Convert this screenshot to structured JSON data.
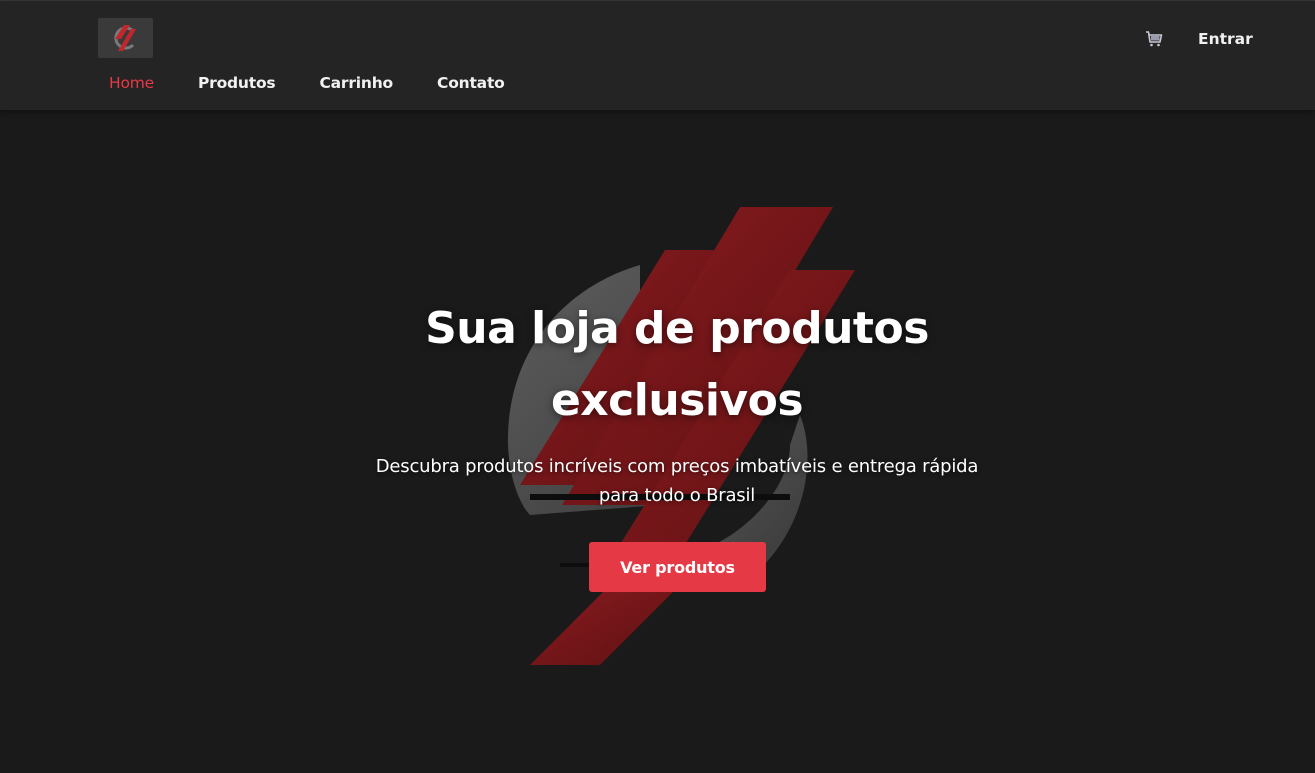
{
  "header": {
    "logo_icon": "brand-logo-icon",
    "nav": [
      {
        "label": "Home",
        "active": true
      },
      {
        "label": "Produtos",
        "active": false
      },
      {
        "label": "Carrinho",
        "active": false
      },
      {
        "label": "Contato",
        "active": false
      }
    ],
    "cart_icon": "shopping-cart-icon",
    "login_label": "Entrar"
  },
  "hero": {
    "background_icon": "brand-logo-icon",
    "title_line1": "Sua loja de produtos",
    "title_line2": "exclusivos",
    "subtitle_line1": "Descubra produtos incríveis com preços imbatíveis e entrega rápida",
    "subtitle_line2": "para todo o Brasil",
    "cta_label": "Ver produtos"
  },
  "colors": {
    "accent": "#e63946",
    "header_bg": "#242424",
    "page_bg": "#1a1a1a"
  }
}
